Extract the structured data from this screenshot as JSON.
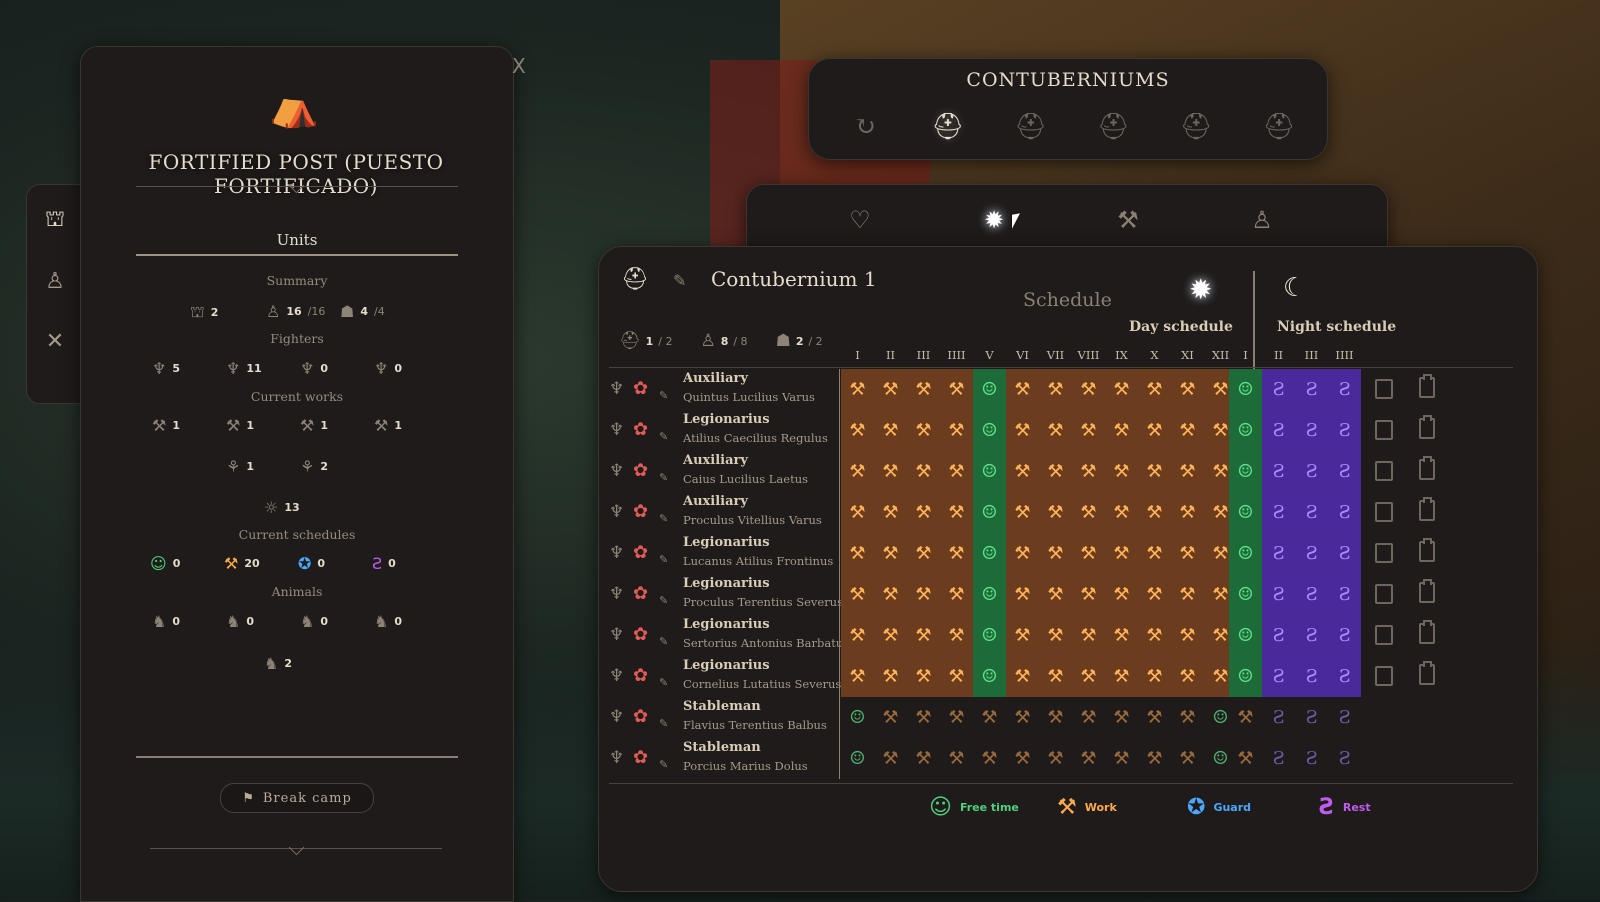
{
  "post": {
    "title": "FORTIFIED POST (PUESTO FORTIFICADO)",
    "close_label": "X",
    "units_tab": "Units",
    "summary_label": "Summary",
    "summary": [
      {
        "icon": "group-icon",
        "value": "2"
      },
      {
        "icon": "soldier-icon",
        "value": "16",
        "sub": "/16"
      },
      {
        "icon": "helmet-icon",
        "value": "4",
        "sub": "/4"
      }
    ],
    "fighters_label": "Fighters",
    "fighters": [
      {
        "icon": "auxiliary-icon",
        "value": "5"
      },
      {
        "icon": "legionary-icon",
        "value": "11"
      },
      {
        "icon": "centurion-icon",
        "value": "0"
      },
      {
        "icon": "optio-icon",
        "value": "0"
      }
    ],
    "works_label": "Current works",
    "works_row1": [
      {
        "icon": "build-icon",
        "value": "1"
      },
      {
        "icon": "axe-icon",
        "value": "1"
      },
      {
        "icon": "forge-icon",
        "value": "1"
      },
      {
        "icon": "cook-icon",
        "value": "1"
      }
    ],
    "works_row2": [
      {
        "icon": "farm-icon",
        "value": "1"
      },
      {
        "icon": "hunt-icon",
        "value": "2"
      }
    ],
    "works_idle": {
      "icon": "idle-icon",
      "value": "13"
    },
    "schedules_label": "Current schedules",
    "schedules": [
      {
        "icon": "free-time-icon",
        "value": "0",
        "color": "#4fd07a"
      },
      {
        "icon": "work-icon",
        "value": "20",
        "color": "#ffa94d"
      },
      {
        "icon": "guard-icon",
        "value": "0",
        "color": "#4aa8ff"
      },
      {
        "icon": "rest-icon",
        "value": "0",
        "color": "#c05cf0"
      }
    ],
    "animals_label": "Animals",
    "animals_row1": [
      {
        "icon": "donkey-icon",
        "value": "0"
      },
      {
        "icon": "dog-icon",
        "value": "0"
      },
      {
        "icon": "goat-icon",
        "value": "0"
      },
      {
        "icon": "pig-icon",
        "value": "0"
      }
    ],
    "animals_row2": {
      "icon": "horse-icon",
      "value": "2"
    },
    "break_camp": "Break camp"
  },
  "contuberniums": {
    "title": "CONTUBERNIUMS",
    "active_index": 1
  },
  "tabs": {
    "active_index": 1
  },
  "contubernium": {
    "name": "Contubernium 1",
    "counts": [
      {
        "icon": "helmet-group-icon",
        "value": "1",
        "sub": " / 2"
      },
      {
        "icon": "soldier-icon",
        "value": "8",
        "sub": " / 8"
      },
      {
        "icon": "helmet-icon",
        "value": "2",
        "sub": " / 2"
      }
    ],
    "schedule_title": "Schedule",
    "day_label": "Day schedule",
    "night_label": "Night schedule",
    "day_hours": [
      "I",
      "II",
      "III",
      "IIII",
      "V",
      "VI",
      "VII",
      "VIII",
      "IX",
      "X",
      "XI",
      "XII"
    ],
    "night_hours": [
      "I",
      "II",
      "III",
      "IIII"
    ],
    "members": [
      {
        "rank": "Auxiliary",
        "name": "Quintus Lucilius Varus",
        "day": [
          "W",
          "W",
          "W",
          "W",
          "F",
          "W",
          "W",
          "W",
          "W",
          "W",
          "W",
          "W"
        ],
        "night": [
          "F",
          "R",
          "R",
          "R"
        ],
        "dim": false
      },
      {
        "rank": "Legionarius",
        "name": "Atilius Caecilius Regulus",
        "day": [
          "W",
          "W",
          "W",
          "W",
          "F",
          "W",
          "W",
          "W",
          "W",
          "W",
          "W",
          "W"
        ],
        "night": [
          "F",
          "R",
          "R",
          "R"
        ],
        "dim": false
      },
      {
        "rank": "Auxiliary",
        "name": "Caius Lucilius Laetus",
        "day": [
          "W",
          "W",
          "W",
          "W",
          "F",
          "W",
          "W",
          "W",
          "W",
          "W",
          "W",
          "W"
        ],
        "night": [
          "F",
          "R",
          "R",
          "R"
        ],
        "dim": false
      },
      {
        "rank": "Auxiliary",
        "name": "Proculus Vitellius Varus",
        "day": [
          "W",
          "W",
          "W",
          "W",
          "F",
          "W",
          "W",
          "W",
          "W",
          "W",
          "W",
          "W"
        ],
        "night": [
          "F",
          "R",
          "R",
          "R"
        ],
        "dim": false
      },
      {
        "rank": "Legionarius",
        "name": "Lucanus Atilius Frontinus",
        "day": [
          "W",
          "W",
          "W",
          "W",
          "F",
          "W",
          "W",
          "W",
          "W",
          "W",
          "W",
          "W"
        ],
        "night": [
          "F",
          "R",
          "R",
          "R"
        ],
        "dim": false
      },
      {
        "rank": "Legionarius",
        "name": "Proculus Terentius Severus",
        "day": [
          "W",
          "W",
          "W",
          "W",
          "F",
          "W",
          "W",
          "W",
          "W",
          "W",
          "W",
          "W"
        ],
        "night": [
          "F",
          "R",
          "R",
          "R"
        ],
        "dim": false
      },
      {
        "rank": "Legionarius",
        "name": "Sertorius Antonius Barbatus",
        "day": [
          "W",
          "W",
          "W",
          "W",
          "F",
          "W",
          "W",
          "W",
          "W",
          "W",
          "W",
          "W"
        ],
        "night": [
          "F",
          "R",
          "R",
          "R"
        ],
        "dim": false
      },
      {
        "rank": "Legionarius",
        "name": "Cornelius Lutatius Severus",
        "day": [
          "W",
          "W",
          "W",
          "W",
          "F",
          "W",
          "W",
          "W",
          "W",
          "W",
          "W",
          "W"
        ],
        "night": [
          "F",
          "R",
          "R",
          "R"
        ],
        "dim": false
      },
      {
        "rank": "Stableman",
        "name": "Flavius Terentius Balbus",
        "day": [
          "F",
          "W",
          "W",
          "W",
          "W",
          "W",
          "W",
          "W",
          "W",
          "W",
          "W",
          "F"
        ],
        "night": [
          "W",
          "R",
          "R",
          "R"
        ],
        "dim": true
      },
      {
        "rank": "Stableman",
        "name": "Porcius Marius Dolus",
        "day": [
          "F",
          "W",
          "W",
          "W",
          "W",
          "W",
          "W",
          "W",
          "W",
          "W",
          "W",
          "F"
        ],
        "night": [
          "W",
          "R",
          "R",
          "R"
        ],
        "dim": true
      }
    ],
    "legend": [
      {
        "key": "F",
        "label": "Free time",
        "icon": "free-time-icon",
        "color": "#4fd07a"
      },
      {
        "key": "W",
        "label": "Work",
        "icon": "work-icon",
        "color": "#ffa94d"
      },
      {
        "key": "G",
        "label": "Guard",
        "icon": "guard-icon",
        "color": "#4aa8ff"
      },
      {
        "key": "R",
        "label": "Rest",
        "icon": "rest-icon",
        "color": "#c05cf0"
      }
    ]
  }
}
